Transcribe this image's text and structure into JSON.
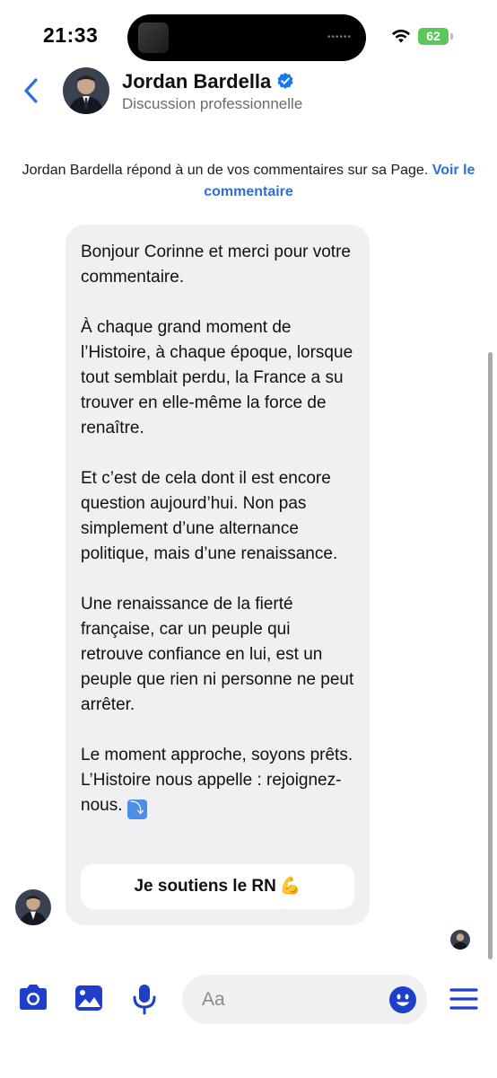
{
  "status_bar": {
    "time": "21:33",
    "battery": "62",
    "island_dots": "••••••"
  },
  "header": {
    "back_icon": "chevron-left-icon",
    "name": "Jordan Bardella",
    "subtitle": "Discussion professionnelle",
    "verified_icon": "verified-badge-icon"
  },
  "notice": {
    "text": "Jordan Bardella répond à un de vos commentaires sur sa Page.",
    "link": "Voir le commentaire"
  },
  "message": {
    "paragraphs": [
      "Bonjour Corinne et merci pour votre commentaire.",
      "À chaque grand moment de l’Histoire, à chaque époque, lorsque tout semblait perdu, la France a su trouver en elle-même la force de renaître.",
      "Et c’est de cela dont il est encore question aujourd’hui. Non pas simplement d’une alternance politique, mais d’une renaissance.",
      "Une renaissance de la fierté française, car un peuple qui retrouve confiance en lui, est un peuple que rien ni personne ne peut arrêter.",
      "Le moment approche, soyons prêts. L’Histoire nous appelle : rejoignez-nous."
    ],
    "arrow_emoji": "⤵",
    "quick_reply": "Je soutiens le RN",
    "quick_reply_emoji": "💪"
  },
  "composer": {
    "placeholder": "Aa",
    "icons": [
      "camera-icon",
      "photo-icon",
      "microphone-icon",
      "emoji-icon",
      "menu-icon"
    ]
  },
  "colors": {
    "accent": "#1d3fc9",
    "link": "#2d6ed9",
    "bubble": "#f0f0f2",
    "verified": "#1877f2",
    "battery": "#5ac85a"
  }
}
